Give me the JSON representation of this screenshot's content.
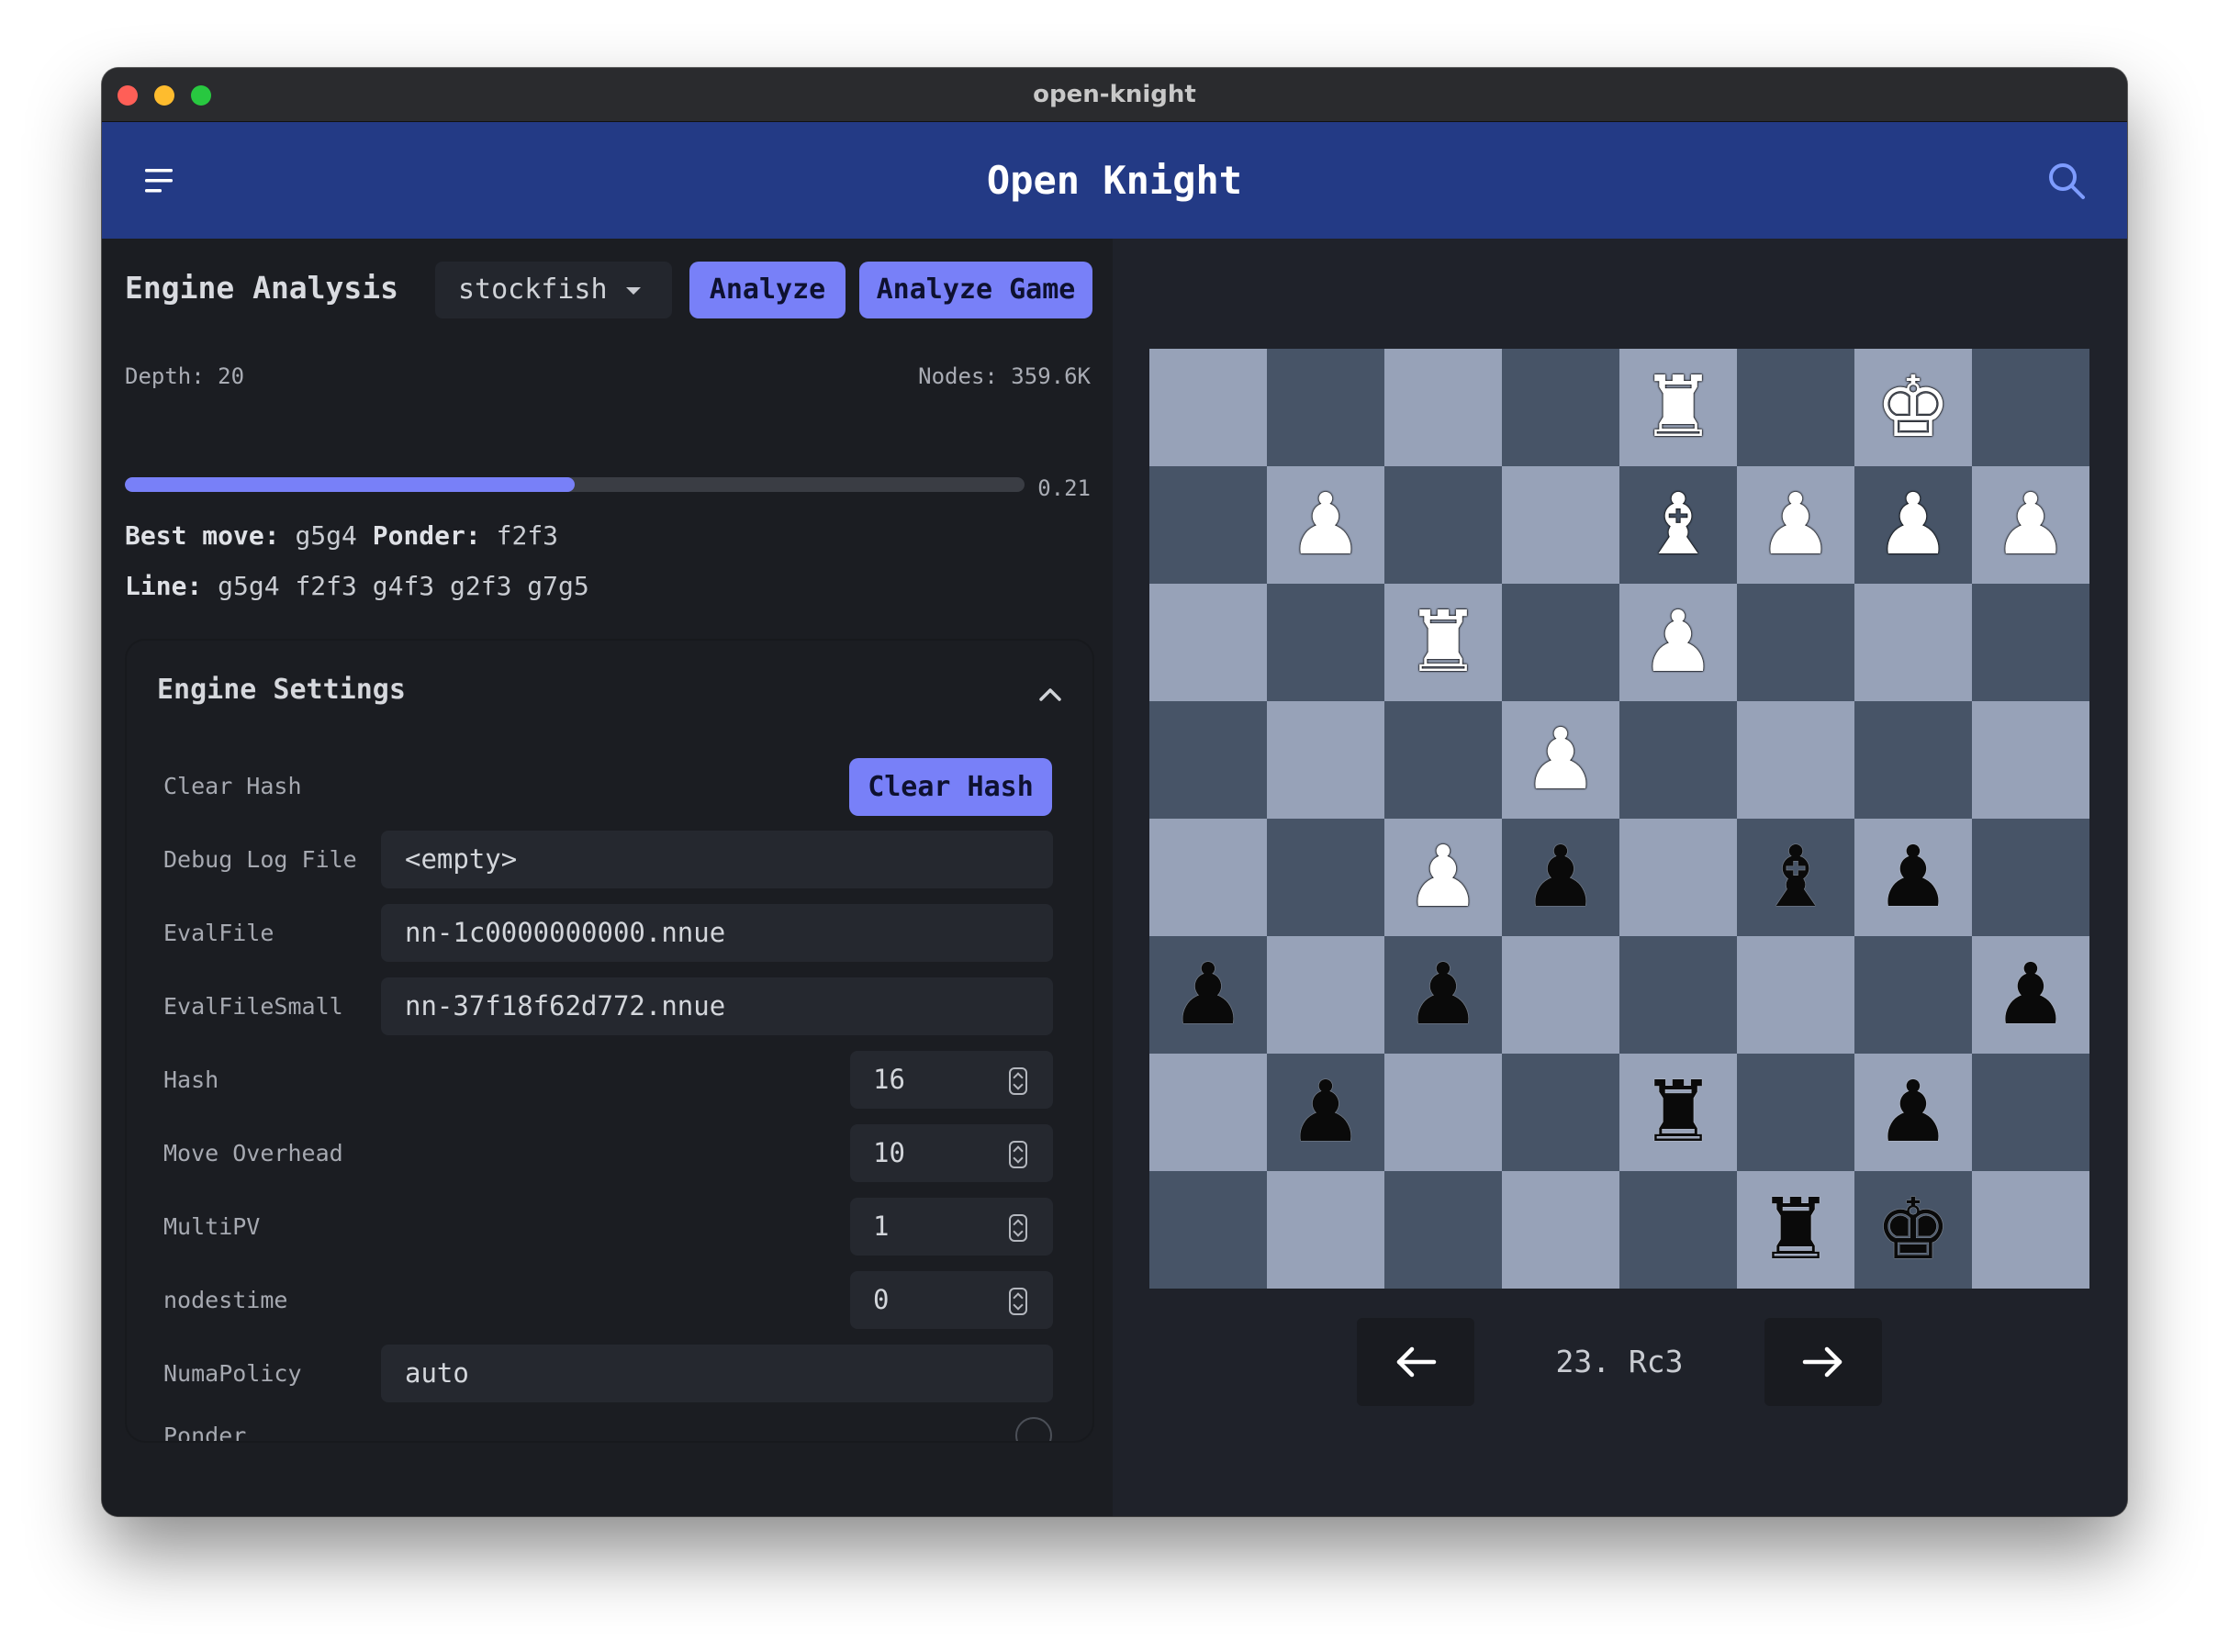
{
  "window": {
    "title": "open-knight"
  },
  "appbar": {
    "title": "Open Knight",
    "menu_icon": "menu-icon",
    "search_icon": "search-icon"
  },
  "analysis": {
    "heading": "Engine Analysis",
    "engine": "stockfish",
    "analyze_label": "Analyze",
    "analyze_game_label": "Analyze Game",
    "depth_text": "Depth: 20",
    "nodes_text": "Nodes: 359.6K",
    "eval_text": "0.21",
    "progress_fraction": 0.5,
    "best_move_label": "Best move:",
    "best_move": "g5g4",
    "ponder_label": "Ponder:",
    "ponder": "f2f3",
    "line_label": "Line:",
    "line": "g5g4 f2f3 g4f3 g2f3 g7g5"
  },
  "settings": {
    "heading": "Engine Settings",
    "clear_hash_label": "Clear Hash",
    "clear_hash_button": "Clear Hash",
    "debug_log_label": "Debug Log File",
    "debug_log_value": "<empty>",
    "evalfile_label": "EvalFile",
    "evalfile_value": "nn-1c0000000000.nnue",
    "evalfilesmall_label": "EvalFileSmall",
    "evalfilesmall_value": "nn-37f18f62d772.nnue",
    "hash_label": "Hash",
    "hash_value": "16",
    "move_overhead_label": "Move Overhead",
    "move_overhead_value": "10",
    "multipv_label": "MultiPV",
    "multipv_value": "1",
    "nodestime_label": "nodestime",
    "nodestime_value": "0",
    "numapolicy_label": "NumaPolicy",
    "numapolicy_value": "auto",
    "ponder_label": "Ponder"
  },
  "board": {
    "light_color": "#97a2b8",
    "dark_color": "#475467",
    "ranks": [
      "....R.K.",
      ".P..BPPP",
      "..R.P...",
      "...P....",
      "..Pp.bp.",
      "p.p....p",
      ".p..r.p.",
      ".....rk."
    ]
  },
  "navigation": {
    "move": "23. Rc3",
    "prev_icon": "arrow-left-icon",
    "next_icon": "arrow-right-icon"
  },
  "colors": {
    "accent": "#7880f8",
    "appbar": "#233a85"
  }
}
